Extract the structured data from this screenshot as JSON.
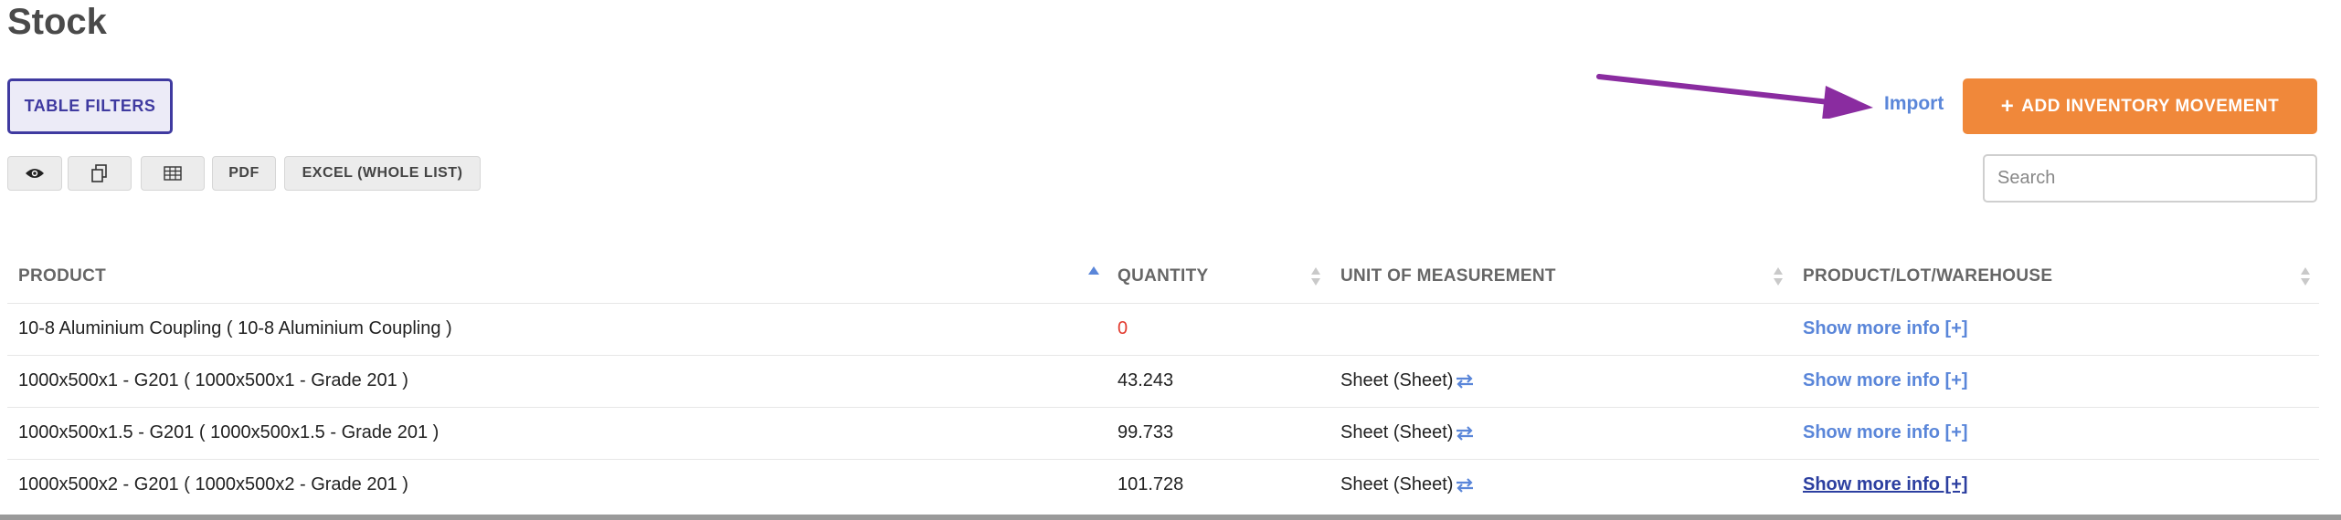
{
  "page": {
    "title": "Stock"
  },
  "toolbar": {
    "filters_label": "TABLE FILTERS",
    "pdf_label": "PDF",
    "excel_label": "EXCEL (WHOLE LIST)",
    "import_label": "Import",
    "add_label": "ADD INVENTORY MOVEMENT",
    "add_icon": "+",
    "search_placeholder": "Search"
  },
  "table": {
    "columns": [
      "PRODUCT",
      "QUANTITY",
      "UNIT OF MEASUREMENT",
      "PRODUCT/LOT/WAREHOUSE"
    ],
    "rows": [
      {
        "product": "10-8 Aluminium Coupling ( 10-8 Aluminium Coupling )",
        "quantity": "0",
        "unit": "",
        "info": "Show more info [+]"
      },
      {
        "product": "1000x500x1 - G201 ( 1000x500x1 - Grade 201 )",
        "quantity": "43.243",
        "unit": "Sheet (Sheet)",
        "info": "Show more info [+]"
      },
      {
        "product": "1000x500x1.5 - G201 ( 1000x500x1.5 - Grade 201 )",
        "quantity": "99.733",
        "unit": "Sheet (Sheet)",
        "info": "Show more info [+]"
      },
      {
        "product": "1000x500x2 - G201 ( 1000x500x2 - Grade 201 )",
        "quantity": "101.728",
        "unit": "Sheet (Sheet)",
        "info": "Show more info [+]"
      }
    ]
  },
  "colors": {
    "accent": "#f0883a",
    "link": "#5a86d9",
    "filters": "#3f3aa0",
    "arrow": "#8a2ca0",
    "zero": "#e23a2e"
  }
}
